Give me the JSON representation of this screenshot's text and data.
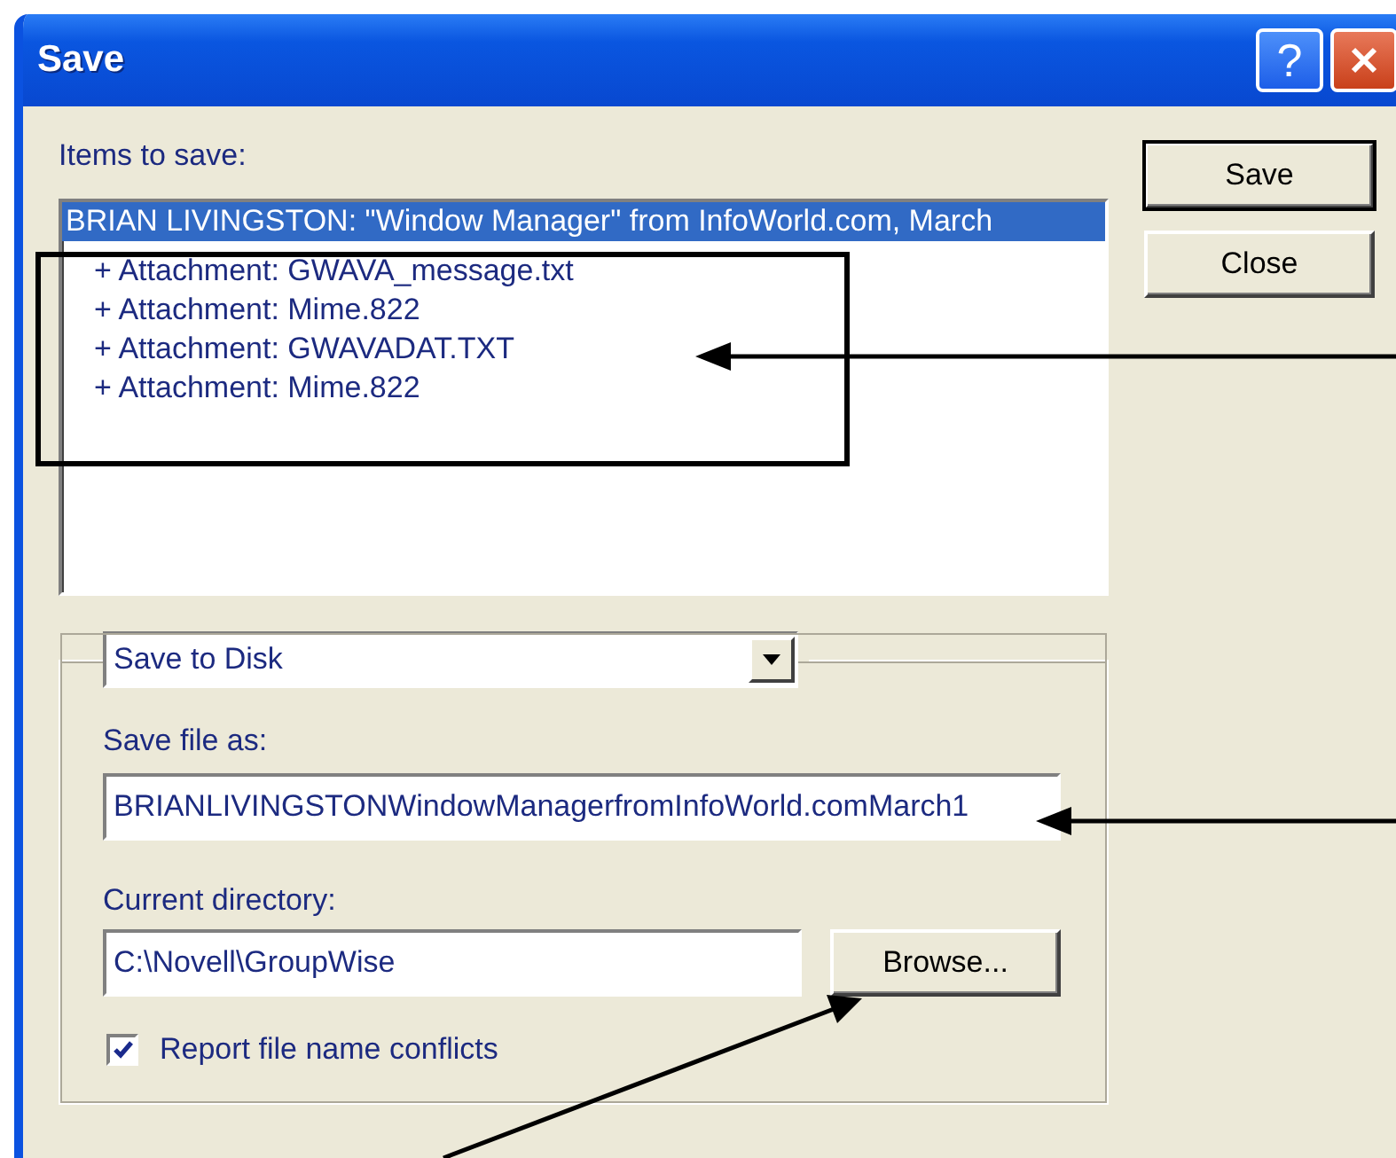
{
  "window": {
    "title": "Save",
    "help_button": "?"
  },
  "items_label": "Items to save:",
  "items": [
    {
      "text": "BRIAN LIVINGSTON: \"Window Manager\" from InfoWorld.com, March",
      "selected": true,
      "children": [
        {
          "text": "+ Attachment: GWAVA_message.txt",
          "selected": false
        },
        {
          "text": "+ Attachment: Mime.822",
          "selected": false
        },
        {
          "text": "+ Attachment: GWAVADAT.TXT",
          "selected": false
        },
        {
          "text": "+ Attachment: Mime.822",
          "selected": false
        }
      ]
    }
  ],
  "buttons": [
    {
      "label": "Save",
      "default": true
    },
    {
      "label": "Close",
      "default": false
    }
  ],
  "save_method": {
    "value": "Save to Disk"
  },
  "save_file_as": {
    "label": "Save file as:",
    "value": "BRIANLIVINGSTONWindowManagerfromInfoWorld.comMarch1"
  },
  "current_directory": {
    "label": "Current directory:",
    "value": "C:\\Novell\\GroupWise"
  },
  "browse_button": "Browse...",
  "report_conflicts": {
    "label": "Report file name conflicts",
    "checked": true
  }
}
